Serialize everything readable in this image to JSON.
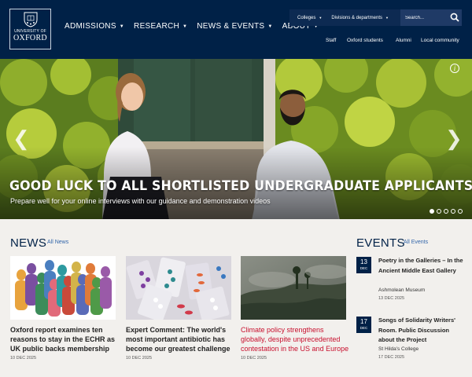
{
  "brand": {
    "line1": "UNIVERSITY OF",
    "line2": "OXFORD",
    "navy": "#002147",
    "red": "#c8102e",
    "link_blue": "#3366aa"
  },
  "main_nav": [
    {
      "label": "ADMISSIONS"
    },
    {
      "label": "RESEARCH"
    },
    {
      "label": "NEWS & EVENTS"
    },
    {
      "label": "ABOUT"
    }
  ],
  "utility": {
    "colleges": "Colleges",
    "divisions": "Divisions & departments",
    "search_placeholder": "Search..."
  },
  "secondary_nav": [
    "Staff",
    "Oxford students",
    "Alumni",
    "Local community"
  ],
  "hero": {
    "title": "GOOD LUCK TO ALL SHORTLISTED UNDERGRADUATE APPLICANTS",
    "subtitle": "Prepare well for your online interviews with our guidance and demonstration videos",
    "info": "i",
    "prev": "❮",
    "next": "❯",
    "slide_count": 5,
    "active_slide": 1
  },
  "news": {
    "heading": "NEWS",
    "all_link": "All News",
    "items": [
      {
        "title": "Oxford report examines ten reasons to stay in the ECHR as UK public backs membership",
        "date": "10 DEC 2025"
      },
      {
        "title": "Expert Comment: The world's most important antibiotic has become our greatest challenge",
        "date": "10 DEC 2025"
      },
      {
        "title": "Climate policy strengthens globally, despite unprecedented contestation in the US and Europe",
        "date": "10 DEC 2025"
      }
    ]
  },
  "events": {
    "heading": "EVENTS",
    "all_link": "All Events",
    "items": [
      {
        "day": "13",
        "month": "DEC",
        "title": "Poetry in the Galleries – In the Ancient Middle East Gallery",
        "venue": "Ashmolean Museum",
        "date": "13 DEC 2025"
      },
      {
        "day": "17",
        "month": "DEC",
        "title": "Songs of Solidarity Writers' Room. Public Discussion about the Project",
        "venue": "St Hilda's College",
        "date": "17 DEC 2025"
      }
    ]
  }
}
